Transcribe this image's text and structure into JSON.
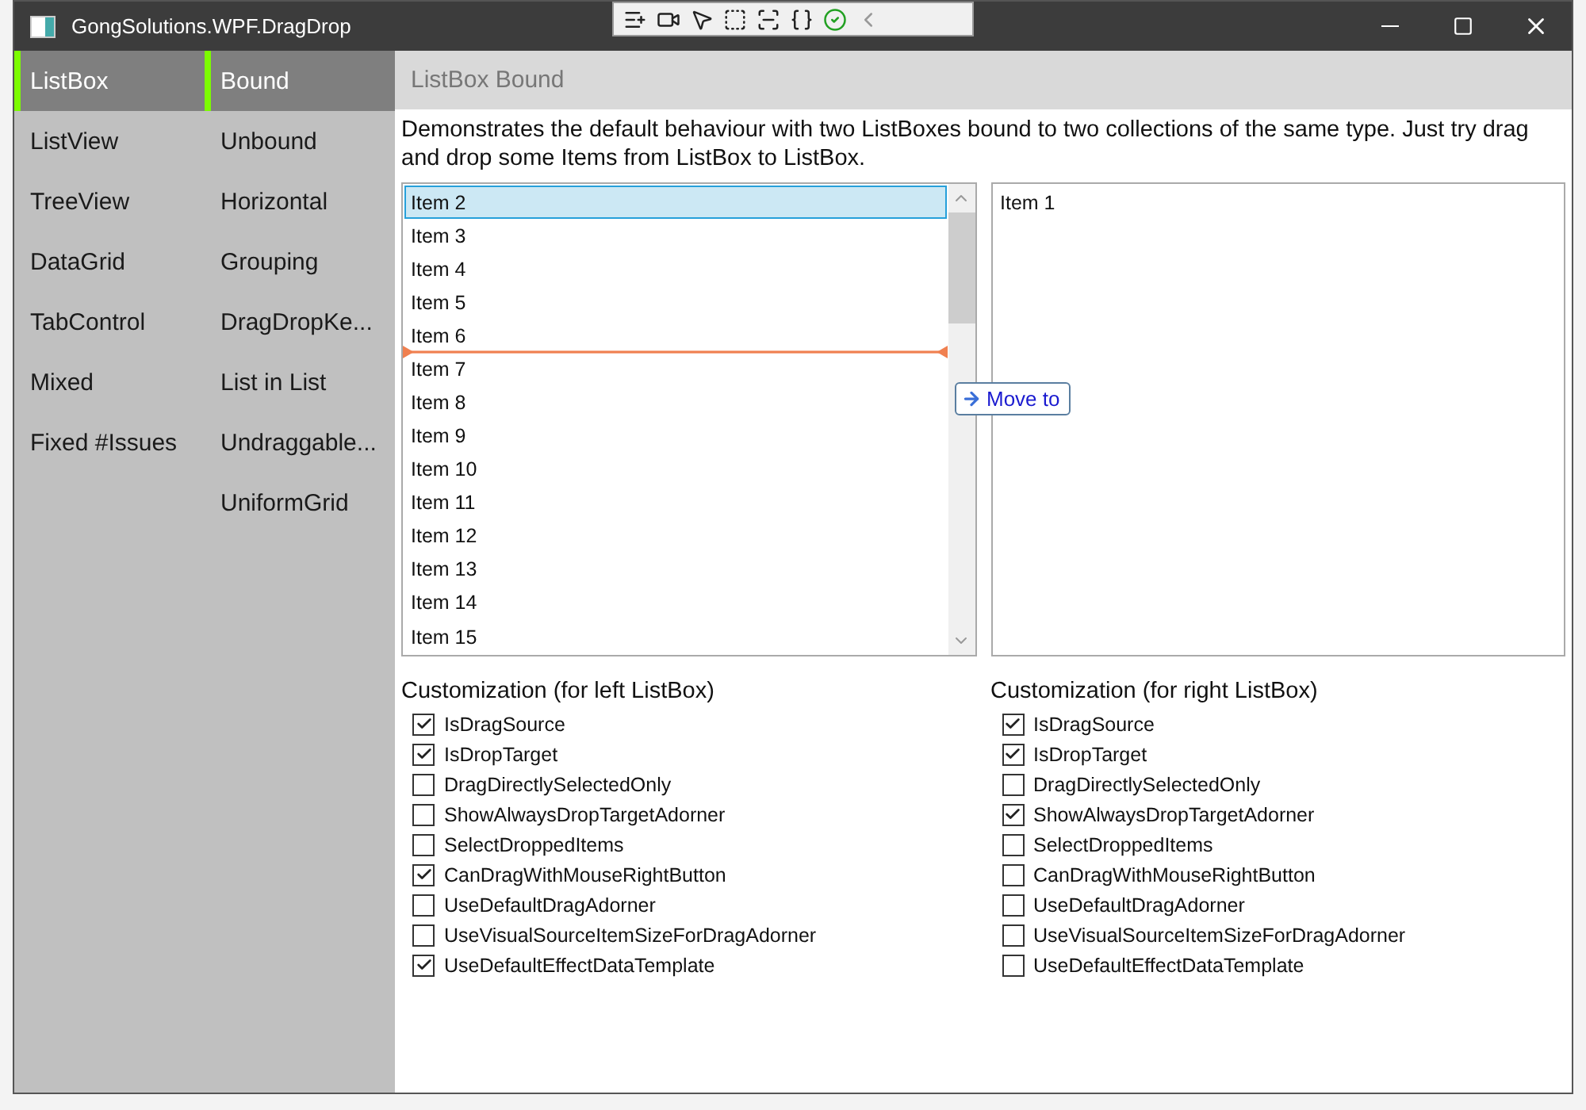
{
  "window": {
    "title": "GongSolutions.WPF.DragDrop"
  },
  "nav": {
    "categories": [
      {
        "label": "ListBox",
        "selected": true
      },
      {
        "label": "ListView",
        "selected": false
      },
      {
        "label": "TreeView",
        "selected": false
      },
      {
        "label": "DataGrid",
        "selected": false
      },
      {
        "label": "TabControl",
        "selected": false
      },
      {
        "label": "Mixed",
        "selected": false
      },
      {
        "label": "Fixed #Issues",
        "selected": false
      }
    ],
    "samples": [
      {
        "label": "Bound",
        "selected": true
      },
      {
        "label": "Unbound",
        "selected": false
      },
      {
        "label": "Horizontal",
        "selected": false
      },
      {
        "label": "Grouping",
        "selected": false
      },
      {
        "label": "DragDropKe...",
        "selected": false
      },
      {
        "label": "List in List",
        "selected": false
      },
      {
        "label": "Undraggable...",
        "selected": false
      },
      {
        "label": "UniformGrid",
        "selected": false
      }
    ]
  },
  "header": "ListBox Bound",
  "description": "Demonstrates the default behaviour with two ListBoxes bound to two collections of the same type. Just try drag and drop some Items from ListBox to ListBox.",
  "left_list": {
    "items": [
      {
        "label": "Item 2",
        "selected": true,
        "drop_before": false
      },
      {
        "label": "Item 3",
        "selected": false,
        "drop_before": false
      },
      {
        "label": "Item 4",
        "selected": false,
        "drop_before": false
      },
      {
        "label": "Item 5",
        "selected": false,
        "drop_before": false
      },
      {
        "label": "Item 6",
        "selected": false,
        "drop_before": false
      },
      {
        "label": "Item 7",
        "selected": false,
        "drop_before": true
      },
      {
        "label": "Item 8",
        "selected": false,
        "drop_before": false
      },
      {
        "label": "Item 9",
        "selected": false,
        "drop_before": false
      },
      {
        "label": "Item 10",
        "selected": false,
        "drop_before": false
      },
      {
        "label": "Item 11",
        "selected": false,
        "drop_before": false
      },
      {
        "label": "Item 12",
        "selected": false,
        "drop_before": false
      },
      {
        "label": "Item 13",
        "selected": false,
        "drop_before": false
      },
      {
        "label": "Item 14",
        "selected": false,
        "drop_before": false
      },
      {
        "label": "Item 15",
        "selected": false,
        "drop_before": false
      }
    ]
  },
  "drag_adorner": {
    "label": "Move to"
  },
  "right_list": {
    "items": [
      {
        "label": "Item 1",
        "selected": false,
        "drop_before": false
      }
    ]
  },
  "customizations": [
    {
      "title": "Customization (for left ListBox)",
      "options": [
        {
          "label": "IsDragSource",
          "checked": true
        },
        {
          "label": "IsDropTarget",
          "checked": true
        },
        {
          "label": "DragDirectlySelectedOnly",
          "checked": false
        },
        {
          "label": "ShowAlwaysDropTargetAdorner",
          "checked": false
        },
        {
          "label": "SelectDroppedItems",
          "checked": false
        },
        {
          "label": "CanDragWithMouseRightButton",
          "checked": true
        },
        {
          "label": "UseDefaultDragAdorner",
          "checked": false
        },
        {
          "label": "UseVisualSourceItemSizeForDragAdorner",
          "checked": false
        },
        {
          "label": "UseDefaultEffectDataTemplate",
          "checked": true
        }
      ]
    },
    {
      "title": "Customization (for right ListBox)",
      "options": [
        {
          "label": "IsDragSource",
          "checked": true
        },
        {
          "label": "IsDropTarget",
          "checked": true
        },
        {
          "label": "DragDirectlySelectedOnly",
          "checked": false
        },
        {
          "label": "ShowAlwaysDropTargetAdorner",
          "checked": true
        },
        {
          "label": "SelectDroppedItems",
          "checked": false
        },
        {
          "label": "CanDragWithMouseRightButton",
          "checked": false
        },
        {
          "label": "UseDefaultDragAdorner",
          "checked": false
        },
        {
          "label": "UseVisualSourceItemSizeForDragAdorner",
          "checked": false
        },
        {
          "label": "UseDefaultEffectDataTemplate",
          "checked": false
        }
      ]
    }
  ]
}
